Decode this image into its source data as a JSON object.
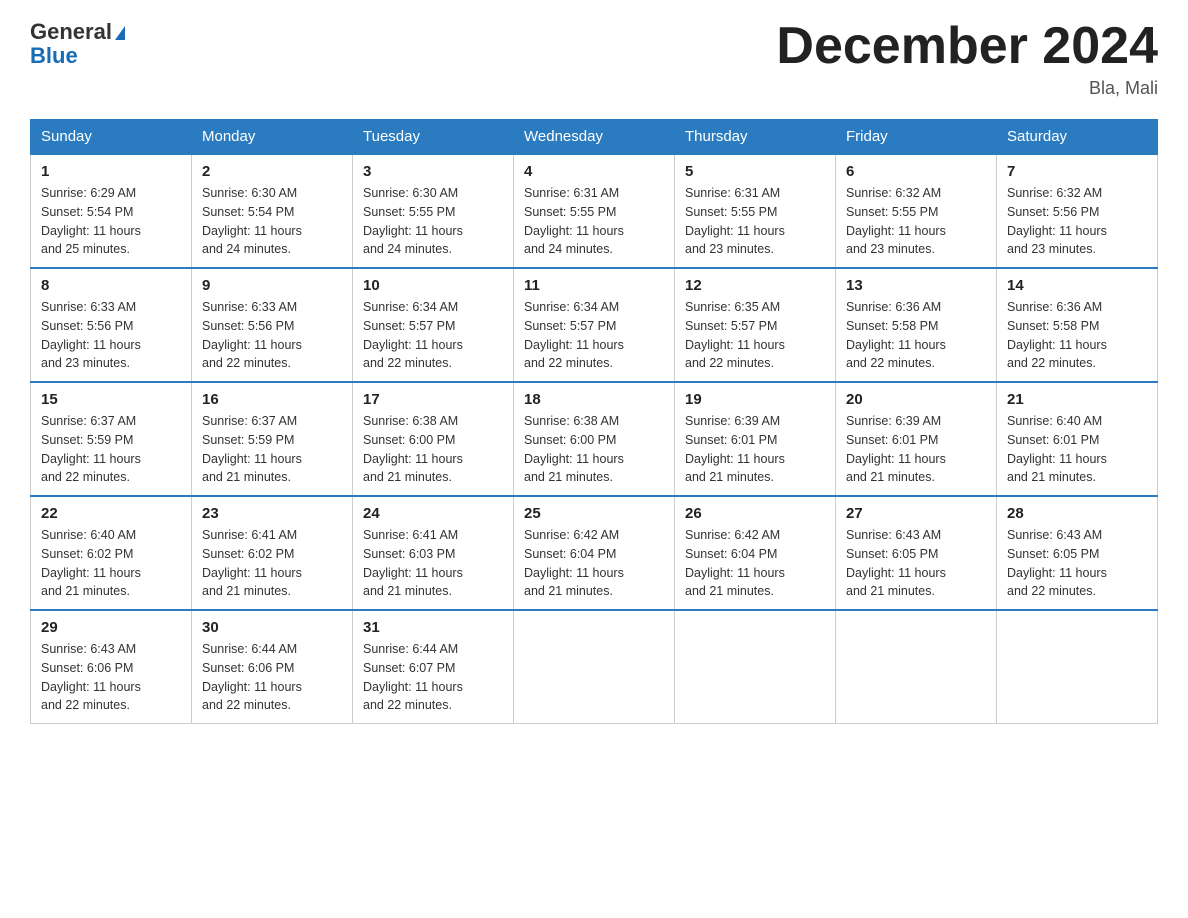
{
  "header": {
    "logo_line1": "General",
    "logo_line2": "Blue",
    "month_title": "December 2024",
    "location": "Bla, Mali"
  },
  "days_of_week": [
    "Sunday",
    "Monday",
    "Tuesday",
    "Wednesday",
    "Thursday",
    "Friday",
    "Saturday"
  ],
  "weeks": [
    [
      {
        "num": "1",
        "sunrise": "6:29 AM",
        "sunset": "5:54 PM",
        "daylight": "11 hours and 25 minutes."
      },
      {
        "num": "2",
        "sunrise": "6:30 AM",
        "sunset": "5:54 PM",
        "daylight": "11 hours and 24 minutes."
      },
      {
        "num": "3",
        "sunrise": "6:30 AM",
        "sunset": "5:55 PM",
        "daylight": "11 hours and 24 minutes."
      },
      {
        "num": "4",
        "sunrise": "6:31 AM",
        "sunset": "5:55 PM",
        "daylight": "11 hours and 24 minutes."
      },
      {
        "num": "5",
        "sunrise": "6:31 AM",
        "sunset": "5:55 PM",
        "daylight": "11 hours and 23 minutes."
      },
      {
        "num": "6",
        "sunrise": "6:32 AM",
        "sunset": "5:55 PM",
        "daylight": "11 hours and 23 minutes."
      },
      {
        "num": "7",
        "sunrise": "6:32 AM",
        "sunset": "5:56 PM",
        "daylight": "11 hours and 23 minutes."
      }
    ],
    [
      {
        "num": "8",
        "sunrise": "6:33 AM",
        "sunset": "5:56 PM",
        "daylight": "11 hours and 23 minutes."
      },
      {
        "num": "9",
        "sunrise": "6:33 AM",
        "sunset": "5:56 PM",
        "daylight": "11 hours and 22 minutes."
      },
      {
        "num": "10",
        "sunrise": "6:34 AM",
        "sunset": "5:57 PM",
        "daylight": "11 hours and 22 minutes."
      },
      {
        "num": "11",
        "sunrise": "6:34 AM",
        "sunset": "5:57 PM",
        "daylight": "11 hours and 22 minutes."
      },
      {
        "num": "12",
        "sunrise": "6:35 AM",
        "sunset": "5:57 PM",
        "daylight": "11 hours and 22 minutes."
      },
      {
        "num": "13",
        "sunrise": "6:36 AM",
        "sunset": "5:58 PM",
        "daylight": "11 hours and 22 minutes."
      },
      {
        "num": "14",
        "sunrise": "6:36 AM",
        "sunset": "5:58 PM",
        "daylight": "11 hours and 22 minutes."
      }
    ],
    [
      {
        "num": "15",
        "sunrise": "6:37 AM",
        "sunset": "5:59 PM",
        "daylight": "11 hours and 22 minutes."
      },
      {
        "num": "16",
        "sunrise": "6:37 AM",
        "sunset": "5:59 PM",
        "daylight": "11 hours and 21 minutes."
      },
      {
        "num": "17",
        "sunrise": "6:38 AM",
        "sunset": "6:00 PM",
        "daylight": "11 hours and 21 minutes."
      },
      {
        "num": "18",
        "sunrise": "6:38 AM",
        "sunset": "6:00 PM",
        "daylight": "11 hours and 21 minutes."
      },
      {
        "num": "19",
        "sunrise": "6:39 AM",
        "sunset": "6:01 PM",
        "daylight": "11 hours and 21 minutes."
      },
      {
        "num": "20",
        "sunrise": "6:39 AM",
        "sunset": "6:01 PM",
        "daylight": "11 hours and 21 minutes."
      },
      {
        "num": "21",
        "sunrise": "6:40 AM",
        "sunset": "6:01 PM",
        "daylight": "11 hours and 21 minutes."
      }
    ],
    [
      {
        "num": "22",
        "sunrise": "6:40 AM",
        "sunset": "6:02 PM",
        "daylight": "11 hours and 21 minutes."
      },
      {
        "num": "23",
        "sunrise": "6:41 AM",
        "sunset": "6:02 PM",
        "daylight": "11 hours and 21 minutes."
      },
      {
        "num": "24",
        "sunrise": "6:41 AM",
        "sunset": "6:03 PM",
        "daylight": "11 hours and 21 minutes."
      },
      {
        "num": "25",
        "sunrise": "6:42 AM",
        "sunset": "6:04 PM",
        "daylight": "11 hours and 21 minutes."
      },
      {
        "num": "26",
        "sunrise": "6:42 AM",
        "sunset": "6:04 PM",
        "daylight": "11 hours and 21 minutes."
      },
      {
        "num": "27",
        "sunrise": "6:43 AM",
        "sunset": "6:05 PM",
        "daylight": "11 hours and 21 minutes."
      },
      {
        "num": "28",
        "sunrise": "6:43 AM",
        "sunset": "6:05 PM",
        "daylight": "11 hours and 22 minutes."
      }
    ],
    [
      {
        "num": "29",
        "sunrise": "6:43 AM",
        "sunset": "6:06 PM",
        "daylight": "11 hours and 22 minutes."
      },
      {
        "num": "30",
        "sunrise": "6:44 AM",
        "sunset": "6:06 PM",
        "daylight": "11 hours and 22 minutes."
      },
      {
        "num": "31",
        "sunrise": "6:44 AM",
        "sunset": "6:07 PM",
        "daylight": "11 hours and 22 minutes."
      },
      null,
      null,
      null,
      null
    ]
  ],
  "labels": {
    "sunrise_prefix": "Sunrise: ",
    "sunset_prefix": "Sunset: ",
    "daylight_prefix": "Daylight: "
  }
}
